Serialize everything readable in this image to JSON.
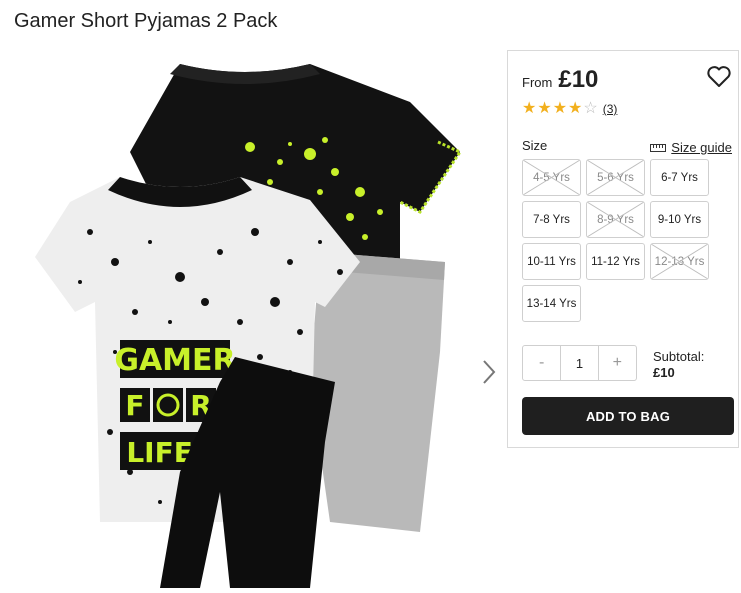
{
  "product": {
    "title": "Gamer Short Pyjamas 2 Pack",
    "image_alt": "Gamer Short Pyjamas 2 Pack"
  },
  "panel": {
    "from_label": "From",
    "price": "£10",
    "rating": {
      "value": 4.5,
      "max": 5,
      "reviews": "(3)"
    },
    "size_label": "Size",
    "size_guide_label": "Size guide",
    "sizes": [
      {
        "label": "4-5 Yrs",
        "available": false
      },
      {
        "label": "5-6 Yrs",
        "available": false
      },
      {
        "label": "6-7 Yrs",
        "available": true
      },
      {
        "label": "7-8 Yrs",
        "available": true
      },
      {
        "label": "8-9 Yrs",
        "available": false
      },
      {
        "label": "9-10 Yrs",
        "available": true
      },
      {
        "label": "10-11 Yrs",
        "available": true
      },
      {
        "label": "11-12 Yrs",
        "available": true
      },
      {
        "label": "12-13 Yrs",
        "available": false
      },
      {
        "label": "13-14 Yrs",
        "available": true
      }
    ],
    "quantity": {
      "minus": "-",
      "value": "1",
      "plus": "+"
    },
    "subtotal_label": "Subtotal:",
    "subtotal_value": "£10",
    "add_to_bag": "ADD TO BAG"
  },
  "graphics": {
    "print_text": [
      "GAMER",
      "F",
      "R",
      "LIFE!"
    ],
    "accent_neon": "#c8f02a",
    "price_star_color": "#f2b01e",
    "button_color": "#1f1f1f"
  }
}
